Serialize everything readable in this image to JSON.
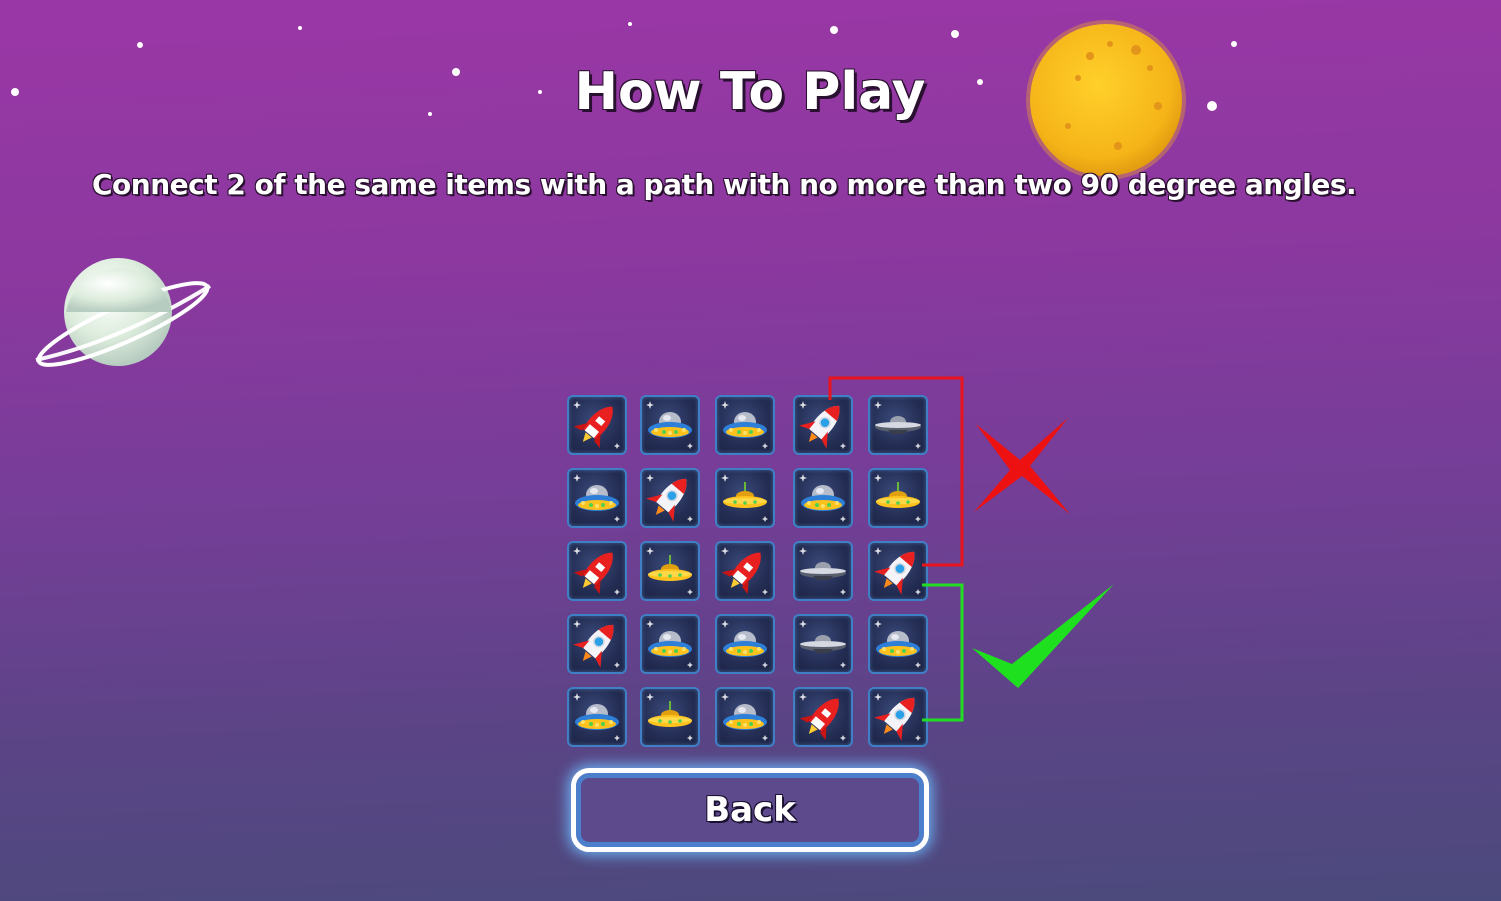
{
  "title": "How To Play",
  "instruction": "Connect 2 of the same items with a path with no more than two 90 degree angles.",
  "back_button_label": "Back",
  "colors": {
    "invalid_path": "#e8141c",
    "valid_path": "#22dd22",
    "tile_border": "#3f7fc6"
  },
  "grid": [
    [
      "red-rocket-icon",
      "blue-ufo-icon",
      "blue-ufo-icon",
      "white-rocket-icon",
      "dark-ufo-icon"
    ],
    [
      "blue-ufo-icon",
      "white-rocket-icon",
      "gold-ufo-icon",
      "blue-ufo-icon",
      "gold-ufo-icon"
    ],
    [
      "red-rocket-icon",
      "gold-ufo-icon",
      "red-rocket-icon",
      "dark-ufo-icon",
      "white-rocket-icon"
    ],
    [
      "white-rocket-icon",
      "blue-ufo-icon",
      "blue-ufo-icon",
      "dark-ufo-icon",
      "blue-ufo-icon"
    ],
    [
      "blue-ufo-icon",
      "gold-ufo-icon",
      "blue-ufo-icon",
      "red-rocket-icon",
      "white-rocket-icon"
    ]
  ],
  "examples": {
    "invalid": {
      "marker": "cross-icon"
    },
    "valid": {
      "marker": "checkmark-icon"
    }
  }
}
